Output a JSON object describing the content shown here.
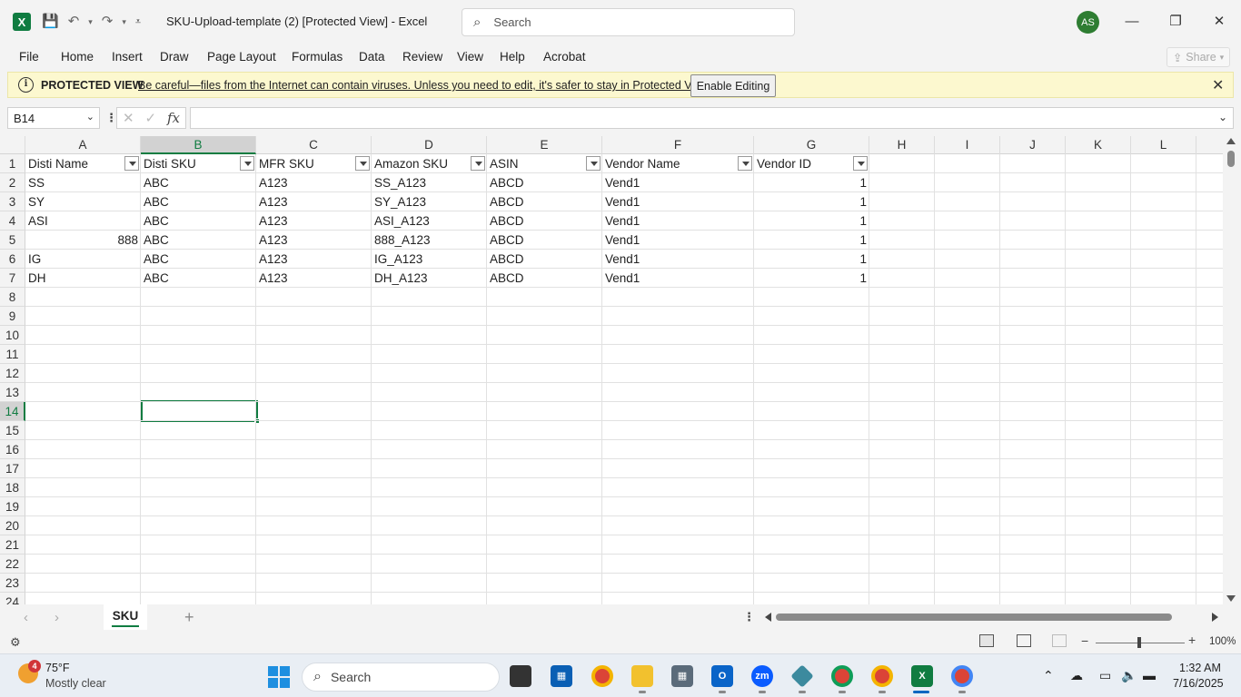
{
  "window": {
    "title": "SKU-Upload-template (2)  [Protected View]  -  Excel",
    "search_placeholder": "Search",
    "avatar_initials": "AS",
    "minimize": "—",
    "restore": "❐",
    "close": "✕"
  },
  "ribbon": {
    "tabs": [
      "File",
      "Home",
      "Insert",
      "Draw",
      "Page Layout",
      "Formulas",
      "Data",
      "Review",
      "View",
      "Help",
      "Acrobat"
    ],
    "share_label": "Share"
  },
  "protected_view": {
    "title": "PROTECTED VIEW",
    "message": "Be careful—files from the Internet can contain viruses. Unless you need to edit, it's safer to stay in Protected View.",
    "button_label": "Enable Editing"
  },
  "formula_bar": {
    "name_box": "B14",
    "formula": ""
  },
  "grid": {
    "columns": [
      "A",
      "B",
      "C",
      "D",
      "E",
      "F",
      "G",
      "H",
      "I",
      "J",
      "K",
      "L"
    ],
    "selected_column": "B",
    "selected_row": "14",
    "row_numbers": [
      "1",
      "2",
      "3",
      "4",
      "5",
      "6",
      "7",
      "8",
      "9",
      "10",
      "11",
      "12",
      "13",
      "14",
      "15",
      "16",
      "17",
      "18",
      "19",
      "20",
      "21",
      "22",
      "23",
      "24"
    ],
    "headers": [
      "Disti Name",
      "Disti SKU",
      "MFR SKU",
      "Amazon SKU",
      "ASIN",
      "Vendor Name",
      "Vendor ID"
    ],
    "rows": [
      [
        "SS",
        "ABC",
        "A123",
        "SS_A123",
        "ABCD",
        "Vend1",
        "1"
      ],
      [
        "SY",
        "ABC",
        "A123",
        "SY_A123",
        "ABCD",
        "Vend1",
        "1"
      ],
      [
        "ASI",
        "ABC",
        "A123",
        "ASI_A123",
        "ABCD",
        "Vend1",
        "1"
      ],
      [
        "888",
        "ABC",
        "A123",
        "888_A123",
        "ABCD",
        "Vend1",
        "1"
      ],
      [
        "IG",
        "ABC",
        "A123",
        "IG_A123",
        "ABCD",
        "Vend1",
        "1"
      ],
      [
        "DH",
        "ABC",
        "A123",
        "DH_A123",
        "ABCD",
        "Vend1",
        "1"
      ]
    ]
  },
  "sheets": {
    "tabs": [
      "SKU"
    ],
    "active": "SKU"
  },
  "status": {
    "zoom": "100%"
  },
  "taskbar": {
    "weather_temp": "75°F",
    "weather_desc": "Mostly clear",
    "weather_badge": "4",
    "search_label": "Search",
    "time": "1:32 AM",
    "date": "7/16/2025"
  },
  "colors": {
    "excel_green": "#107c41",
    "protected_bar": "#fcf8cf"
  }
}
